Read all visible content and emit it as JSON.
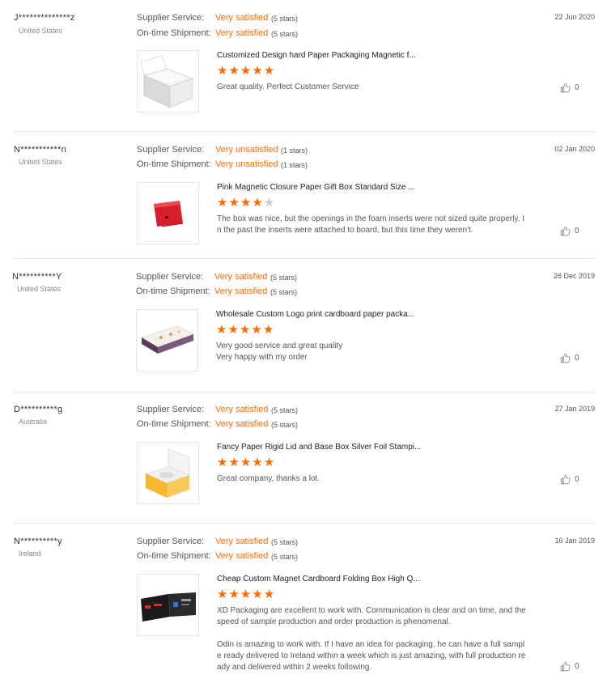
{
  "colors": {
    "accent": "#ff6a00",
    "separator": "#e3e3e3"
  },
  "labels": {
    "supplier_service": "Supplier Service:",
    "ontime_shipment": "On-time Shipment:"
  },
  "reviews": [
    {
      "buyer": "J**************z",
      "country": "United States",
      "date": "22 Jun 2020",
      "supplier_rating": "Very satisfied",
      "supplier_stars": "(5 stars)",
      "shipment_rating": "Very satisfied",
      "shipment_stars": "(5 stars)",
      "product_title": "Customized Design hard Paper Packaging Magnetic f...",
      "rating": 5,
      "product_icon": "white-magnetic-box-image",
      "text": [
        "Great quality. Perfect Customer Service"
      ],
      "likes": "0"
    },
    {
      "buyer": "N***********n",
      "country": "United States",
      "date": "02 Jan 2020",
      "supplier_rating": "Very unsatisfied",
      "supplier_stars": "(1 stars)",
      "shipment_rating": "Very unsatisfied",
      "shipment_stars": "(1 stars)",
      "product_title": "Pink Magnetic Closure Paper Gift Box Standard Size ...",
      "rating": 4,
      "product_icon": "red-gift-box-image",
      "text": [
        "The box was nice, but the openings in the foam inserts were not sized quite properly. In the past the inserts were attached to board, but this time they weren't."
      ],
      "likes": "0"
    },
    {
      "buyer": "N**********Y",
      "country": "United States",
      "date": "26 Dec 2019",
      "supplier_rating": "Very satisfied",
      "supplier_stars": "(5 stars)",
      "shipment_rating": "Very satisfied",
      "shipment_stars": "(5 stars)",
      "product_title": "Wholesale Custom Logo print cardboard paper packa...",
      "rating": 5,
      "product_icon": "drawer-box-image",
      "text": [
        "Very good service and great quality\nVery happy with my order"
      ],
      "likes": "0"
    },
    {
      "buyer": "D**********g",
      "country": "Australia",
      "date": "27 Jan 2019",
      "supplier_rating": "Very satisfied",
      "supplier_stars": "(5 stars)",
      "shipment_rating": "Very satisfied",
      "shipment_stars": "(5 stars)",
      "product_title": "Fancy Paper Rigid Lid and Base Box Silver Foil Stampi...",
      "rating": 5,
      "product_icon": "yellow-lid-box-image",
      "text": [
        "Great company, thanks a lot."
      ],
      "likes": "0"
    },
    {
      "buyer": "N**********y",
      "country": "Ireland",
      "date": "16 Jan 2019",
      "supplier_rating": "Very satisfied",
      "supplier_stars": "(5 stars)",
      "shipment_rating": "Very satisfied",
      "shipment_stars": "(5 stars)",
      "product_title": "Cheap Custom Magnet Cardboard Folding Box High Q...",
      "rating": 5,
      "product_icon": "black-folding-box-image",
      "text": [
        "XD Packaging are excellent to work with. Communication is clear and on time, and the speed of sample production and order production is phenomenal.",
        "Odin is amazing to work with. If I have an idea for packaging, he can have a full sample ready delivered to Ireland within a week which is just amazing, with full production ready and delivered within 2 weeks following."
      ],
      "likes": "0"
    }
  ]
}
